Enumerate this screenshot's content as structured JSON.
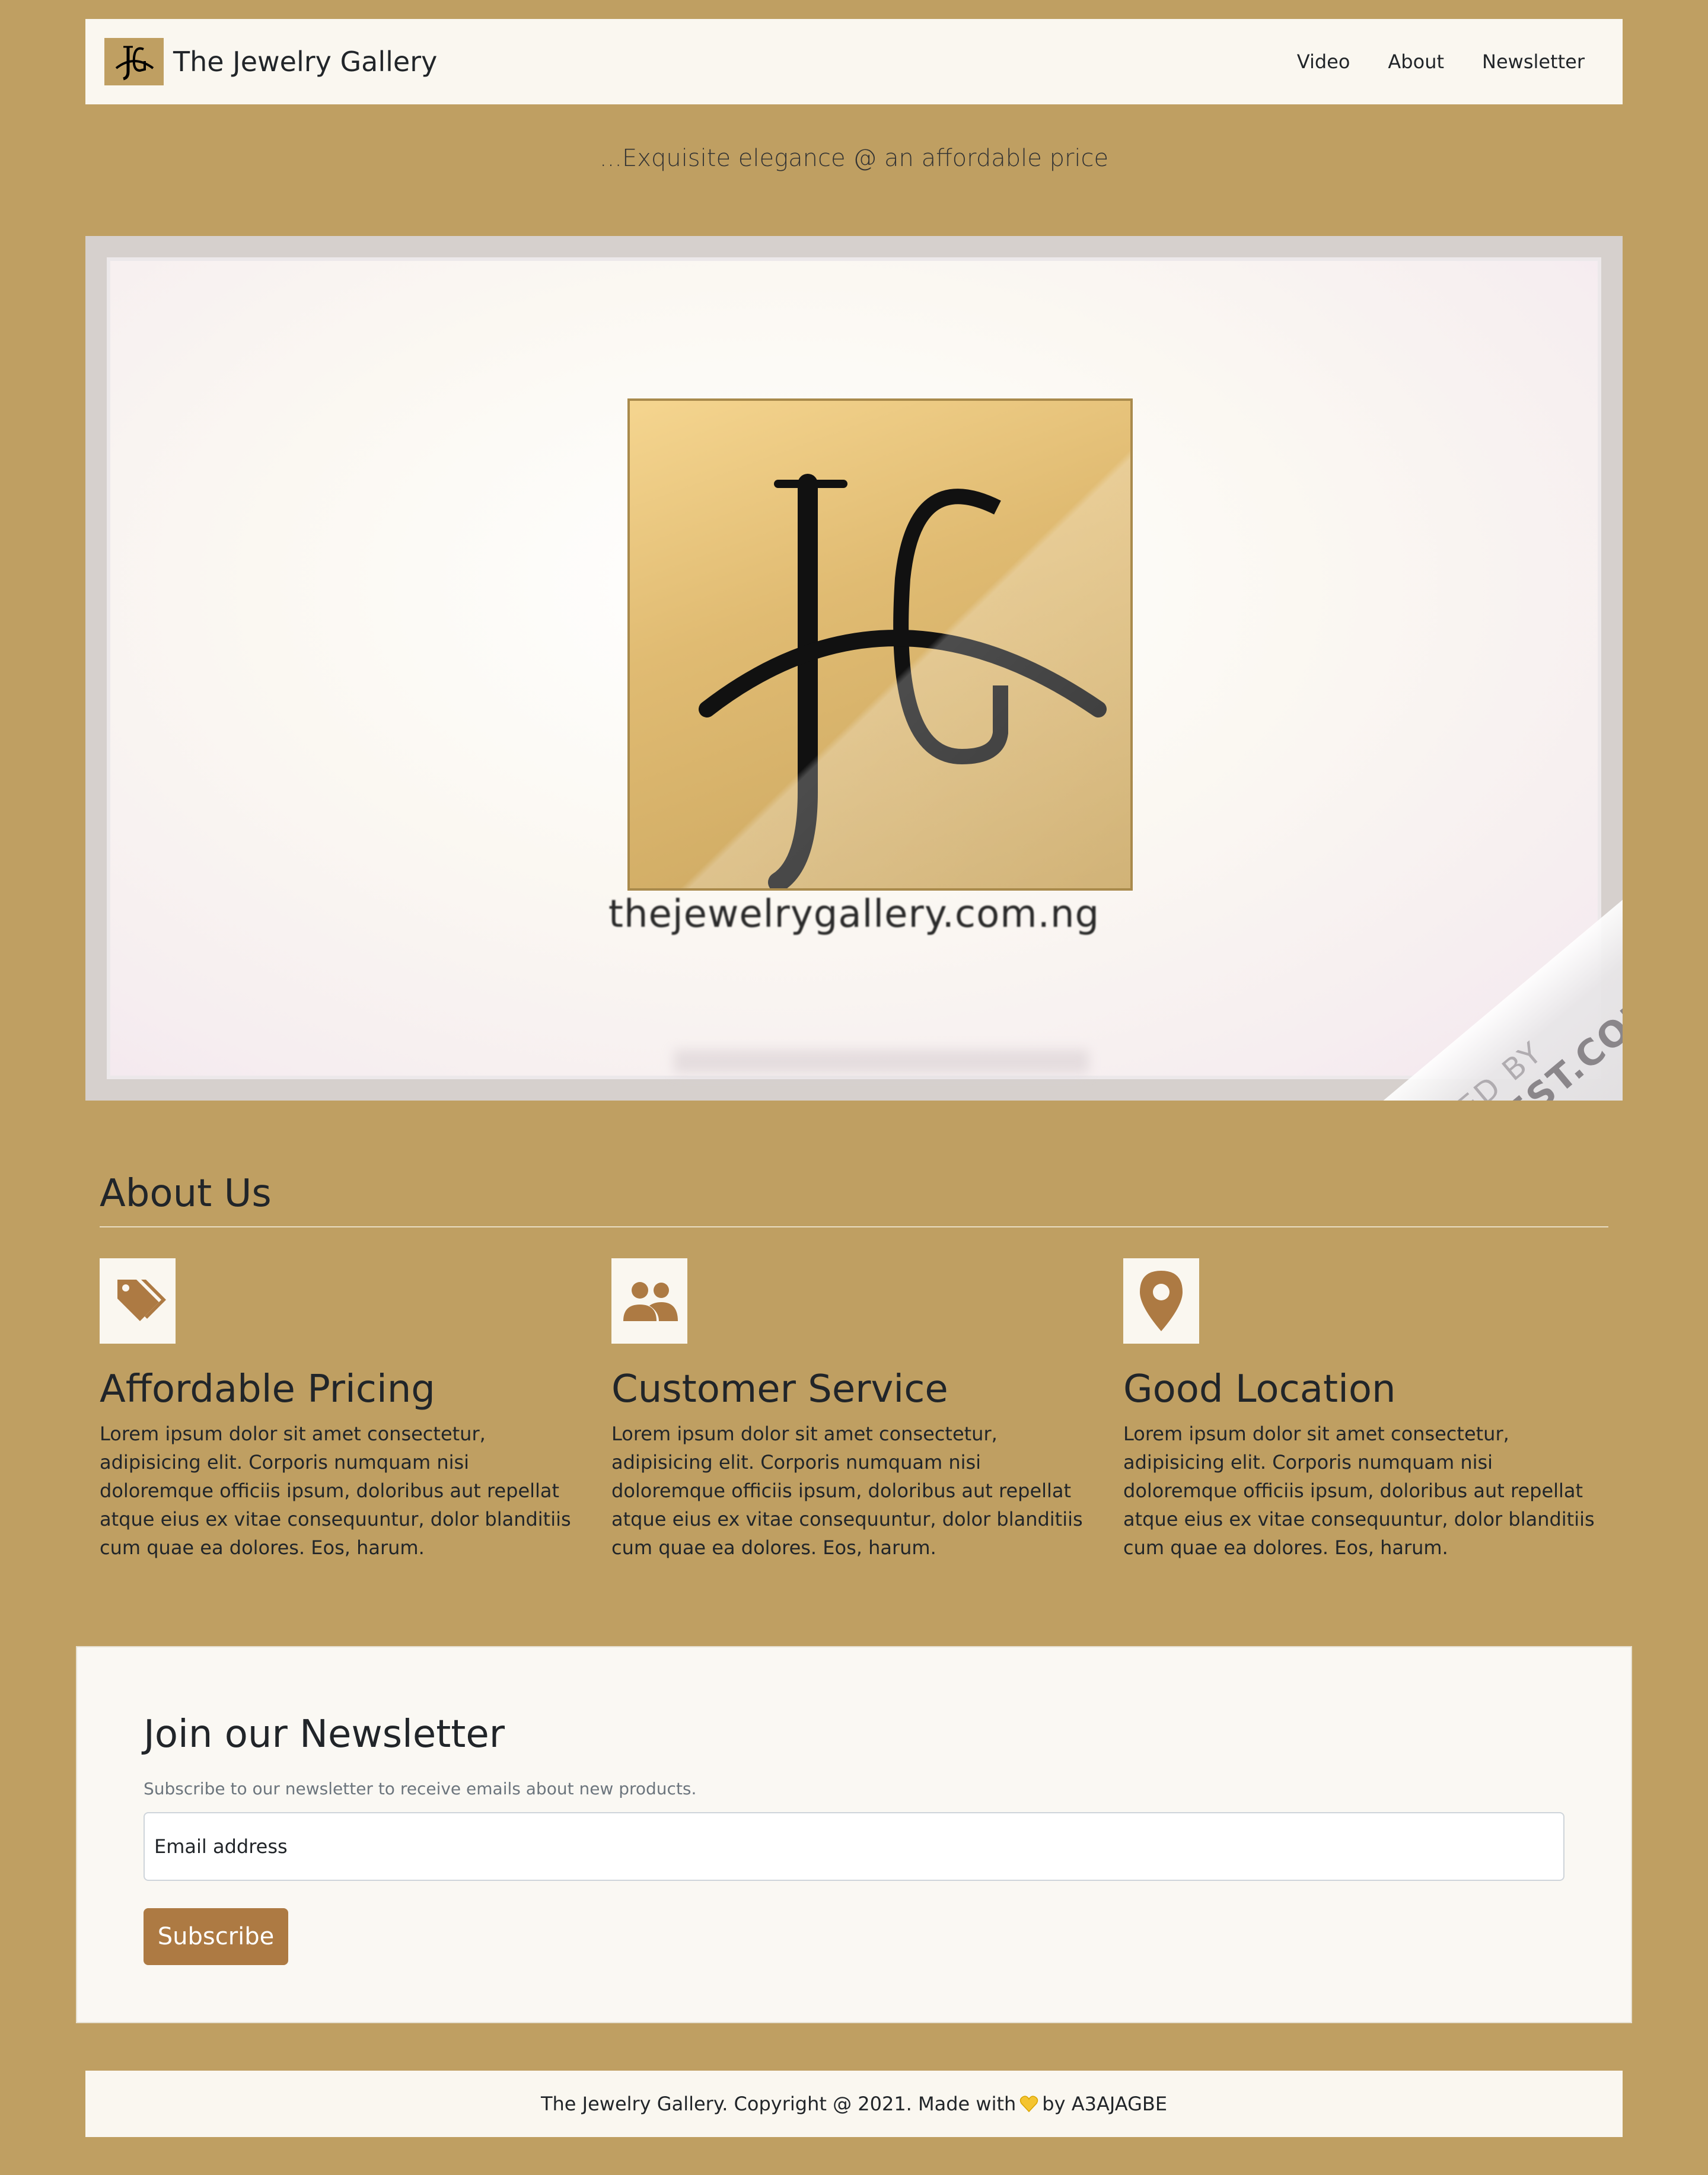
{
  "navbar": {
    "brand_name": "The Jewelry Gallery",
    "brand_logo_text": "JG",
    "links": [
      "Video",
      "About",
      "Newsletter"
    ]
  },
  "tagline": "...Exquisite elegance @ an affordable price",
  "hero": {
    "logo_text": "JG",
    "url_text": "thejewelrygallery.com.ng",
    "watermark_line1": "CREATED BY",
    "watermark_line2": "RENDERFOREST.COM"
  },
  "about": {
    "title": "About Us",
    "features": [
      {
        "icon": "tags-icon",
        "title": "Affordable Pricing",
        "text": "Lorem ipsum dolor sit amet consectetur, adipisicing elit. Corporis numquam nisi doloremque officiis ipsum, doloribus aut repellat atque eius ex vitae consequuntur, dolor blanditiis cum quae ea dolores. Eos, harum."
      },
      {
        "icon": "users-icon",
        "title": "Customer Service",
        "text": "Lorem ipsum dolor sit amet consectetur, adipisicing elit. Corporis numquam nisi doloremque officiis ipsum, doloribus aut repellat atque eius ex vitae consequuntur, dolor blanditiis cum quae ea dolores. Eos, harum."
      },
      {
        "icon": "map-pin-icon",
        "title": "Good Location",
        "text": "Lorem ipsum dolor sit amet consectetur, adipisicing elit. Corporis numquam nisi doloremque officiis ipsum, doloribus aut repellat atque eius ex vitae consequuntur, dolor blanditiis cum quae ea dolores. Eos, harum."
      }
    ]
  },
  "newsletter": {
    "title": "Join our Newsletter",
    "subtitle": "Subscribe to our newsletter to receive emails about new products.",
    "email_placeholder": "Email address",
    "button_label": "Subscribe"
  },
  "footer": {
    "text_before": "The Jewelry Gallery. Copyright @ 2021. Made with",
    "text_after": "by A3AJAGBE",
    "heart_icon": "yellow-heart-icon"
  },
  "colors": {
    "page_background": "#bf9f62",
    "panel_background": "#faf7f0",
    "accent": "#ad7a43",
    "text": "#212529",
    "muted_text": "#6c757d"
  }
}
